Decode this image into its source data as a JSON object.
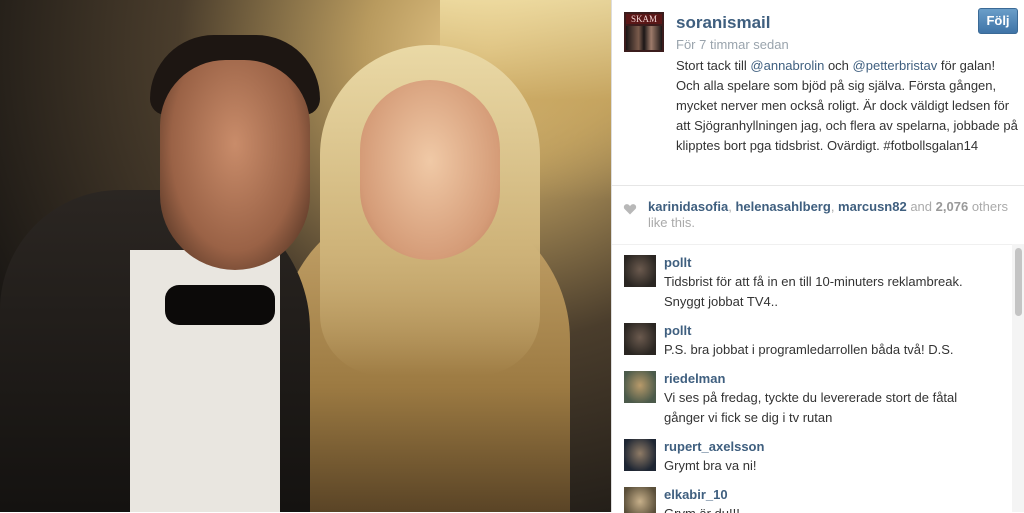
{
  "post": {
    "username": "soranismail",
    "time": "För 7 timmar sedan",
    "follow_label": "Följ",
    "caption_parts": {
      "a": "Stort tack till ",
      "m1": "@annabrolin",
      "b": " och ",
      "m2": "@petterbristav",
      "c": " för galan! Och alla spelare som bjöd på sig själva. Första gången, mycket nerver men också roligt. Är dock väldigt ledsen för att Sjögranhyllningen jag, och flera av spelarna, jobbade på klipptes bort pga tidsbrist. Ovärdigt. #fotbollsgalan14"
    },
    "avatar_logo": "SKAM"
  },
  "likes": {
    "likers": [
      "karinidasofia",
      "helenasahlberg",
      "marcusn82"
    ],
    "and_word": "and",
    "count": "2,076",
    "others": "others like this."
  },
  "comments": [
    {
      "user": "pollt",
      "text": "Tidsbrist för att få in en till 10-minuters reklambreak. Snyggt jobbat TV4..",
      "avatar_colors": [
        "#2a2622",
        "#6b5a4e"
      ]
    },
    {
      "user": "pollt",
      "text": "P.S. bra jobbat i programledarrollen båda två! D.S.",
      "avatar_colors": [
        "#2a2622",
        "#6b5a4e"
      ]
    },
    {
      "user": "riedelman",
      "text": "Vi ses på fredag, tyckte du levererade stort de fåtal gånger vi fick se dig i tv rutan ",
      "avatar_colors": [
        "#4b5a4a",
        "#b89a6a"
      ]
    },
    {
      "user": "rupert_axelsson",
      "text": "Grymt bra va ni!",
      "avatar_colors": [
        "#1e2633",
        "#8f7b66"
      ]
    },
    {
      "user": "elkabir_10",
      "text": "Grym är du!!! ",
      "avatar_colors": [
        "#5a4f3a",
        "#c7b08a"
      ]
    }
  ]
}
